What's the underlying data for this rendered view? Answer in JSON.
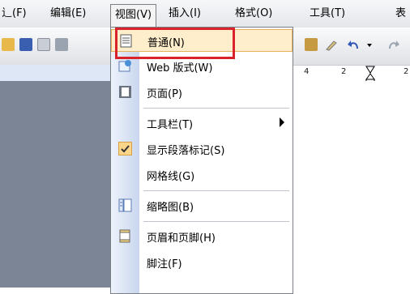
{
  "menubar": {
    "items": [
      {
        "label": "辶(F)"
      },
      {
        "label": "编辑(E)"
      },
      {
        "label": "视图(V)"
      },
      {
        "label": "插入(I)"
      },
      {
        "label": "格式(O)"
      },
      {
        "label": "工具(T)"
      },
      {
        "label": "表"
      }
    ]
  },
  "ruler": {
    "nums": [
      "4",
      "2",
      "2"
    ]
  },
  "view_menu": {
    "items": [
      {
        "label": "普通(N)",
        "icon": "normal-view-icon"
      },
      {
        "label": "Web 版式(W)",
        "icon": "web-layout-icon"
      },
      {
        "label": "页面(P)",
        "icon": "page-layout-icon"
      },
      {
        "label": "工具栏(T)",
        "icon": ""
      },
      {
        "label": "显示段落标记(S)",
        "icon": "checkmark-icon"
      },
      {
        "label": "网格线(G)",
        "icon": ""
      },
      {
        "label": "缩略图(B)",
        "icon": "thumbnail-icon"
      },
      {
        "label": "页眉和页脚(H)",
        "icon": "header-footer-icon"
      },
      {
        "label": "脚注(F)",
        "icon": ""
      }
    ]
  },
  "colors": {
    "highlight": "#ffeecc",
    "annotation": "#d9232a"
  }
}
